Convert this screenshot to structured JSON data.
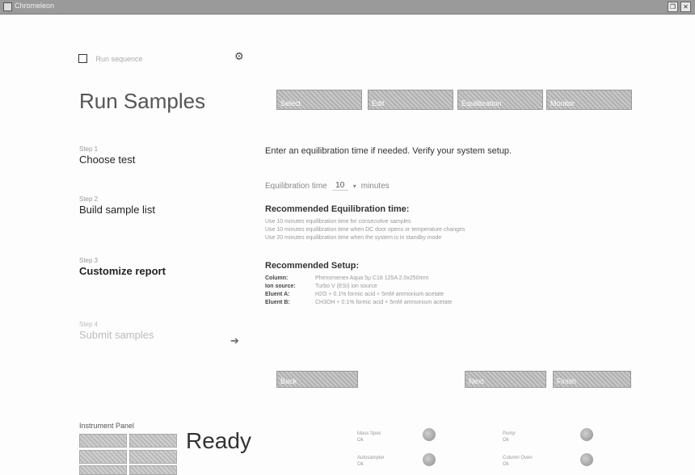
{
  "window": {
    "title": "Chromeleon"
  },
  "top_option": {
    "label": "Run sequence"
  },
  "page_title": "Run Samples",
  "steps": [
    {
      "num": "Step 1",
      "name": "Choose test"
    },
    {
      "num": "Step 2",
      "name": "Build sample list"
    },
    {
      "num": "Step 3",
      "name": "Customize report"
    },
    {
      "num": "Step 4",
      "name": "Submit samples"
    }
  ],
  "tabs": [
    "Select",
    "Edit",
    "Equilibration",
    "Monitor"
  ],
  "instruction": "Enter an equilibration time if needed. Verify your system setup.",
  "equilibration": {
    "label": "Equilibration time",
    "value": "10",
    "unit": "minutes"
  },
  "recommended_equilibration": {
    "title": "Recommended Equilibration time:",
    "lines": [
      "Use 10 minutes equilibration time for consecutive samples",
      "Use 10 minutes equilibration time when DC door opens or temperature changes",
      "Use 20 minutes equilibration time when the system is in standby mode"
    ]
  },
  "recommended_setup": {
    "title": "Recommended Setup:",
    "rows": [
      {
        "k": "Column:",
        "v": "Phenomenex Aqua 5μ C18 125A 2.0x250mm"
      },
      {
        "k": "Ion source:",
        "v": "Turbo V (ESI) ion source"
      },
      {
        "k": "Eluent A:",
        "v": "H2O + 0.1% formic acid + 5mM ammonium acetate"
      },
      {
        "k": "Eluent B:",
        "v": "CH3OH + 0.1% formic acid + 5mM ammonium acetate"
      }
    ]
  },
  "actions": {
    "back": "Back",
    "next": "Next",
    "finish": "Finish"
  },
  "instrument_panel": {
    "label": "Instrument Panel",
    "status": "Ready",
    "indicators": [
      {
        "name": "Mass Spec",
        "sub": "Ok"
      },
      {
        "name": "Pump",
        "sub": "Ok"
      },
      {
        "name": "Autosampler",
        "sub": "Ok"
      },
      {
        "name": "Column Oven",
        "sub": "Ok"
      }
    ]
  },
  "colors": {
    "accent": "#9a9a9a",
    "text": "#333333"
  }
}
